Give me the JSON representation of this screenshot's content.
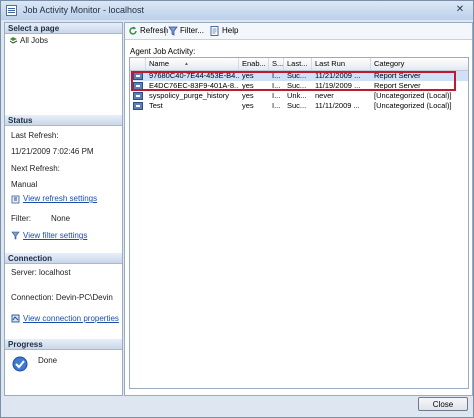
{
  "window": {
    "title": "Job Activity Monitor - localhost"
  },
  "sidebar": {
    "select_page_header": "Select a page",
    "pages": [
      {
        "label": "All Jobs"
      }
    ],
    "status_header": "Status",
    "last_refresh_label": "Last Refresh:",
    "last_refresh_value": "11/21/2009 7:02:46 PM",
    "next_refresh_label": "Next Refresh:",
    "next_refresh_value": "Manual",
    "view_refresh_settings": "View refresh settings",
    "filter_label": "Filter:",
    "filter_value": "None",
    "view_filter_settings": "View filter settings",
    "connection_header": "Connection",
    "server_label": "Server: localhost",
    "connection_label": "Connection: Devin-PC\\Devin",
    "view_connection_properties": "View connection properties",
    "progress_header": "Progress",
    "progress_status": "Done"
  },
  "toolbar": {
    "refresh": "Refresh",
    "filter": "Filter...",
    "help": "Help"
  },
  "grid": {
    "label": "Agent Job Activity:",
    "columns": [
      "Name",
      "Enab...",
      "S...",
      "Last...",
      "Last Run",
      "Category"
    ],
    "sort_indicator": "▲",
    "rows": [
      {
        "name": "97680C40-7E44-453E-B4...",
        "enabled": "yes",
        "status": "I...",
        "outcome": "Suc...",
        "last_run": "11/21/2009 ...",
        "category": "Report Server",
        "selected": true
      },
      {
        "name": "E4DC76EC-83F9-401A-8...",
        "enabled": "yes",
        "status": "I...",
        "outcome": "Suc...",
        "last_run": "11/19/2009 ...",
        "category": "Report Server",
        "selected": false
      },
      {
        "name": "syspolicy_purge_history",
        "enabled": "yes",
        "status": "I...",
        "outcome": "Unk...",
        "last_run": "never",
        "category": "[Uncategorized (Local)]",
        "selected": false
      },
      {
        "name": "Test",
        "enabled": "yes",
        "status": "I...",
        "outcome": "Suc...",
        "last_run": "11/11/2009 ...",
        "category": "[Uncategorized (Local)]",
        "selected": false
      }
    ]
  },
  "footer": {
    "close_label": "Close"
  },
  "colors": {
    "accent": "#1a4ea8",
    "highlight_border": "#c0182d",
    "selection": "#cfe1f7"
  }
}
